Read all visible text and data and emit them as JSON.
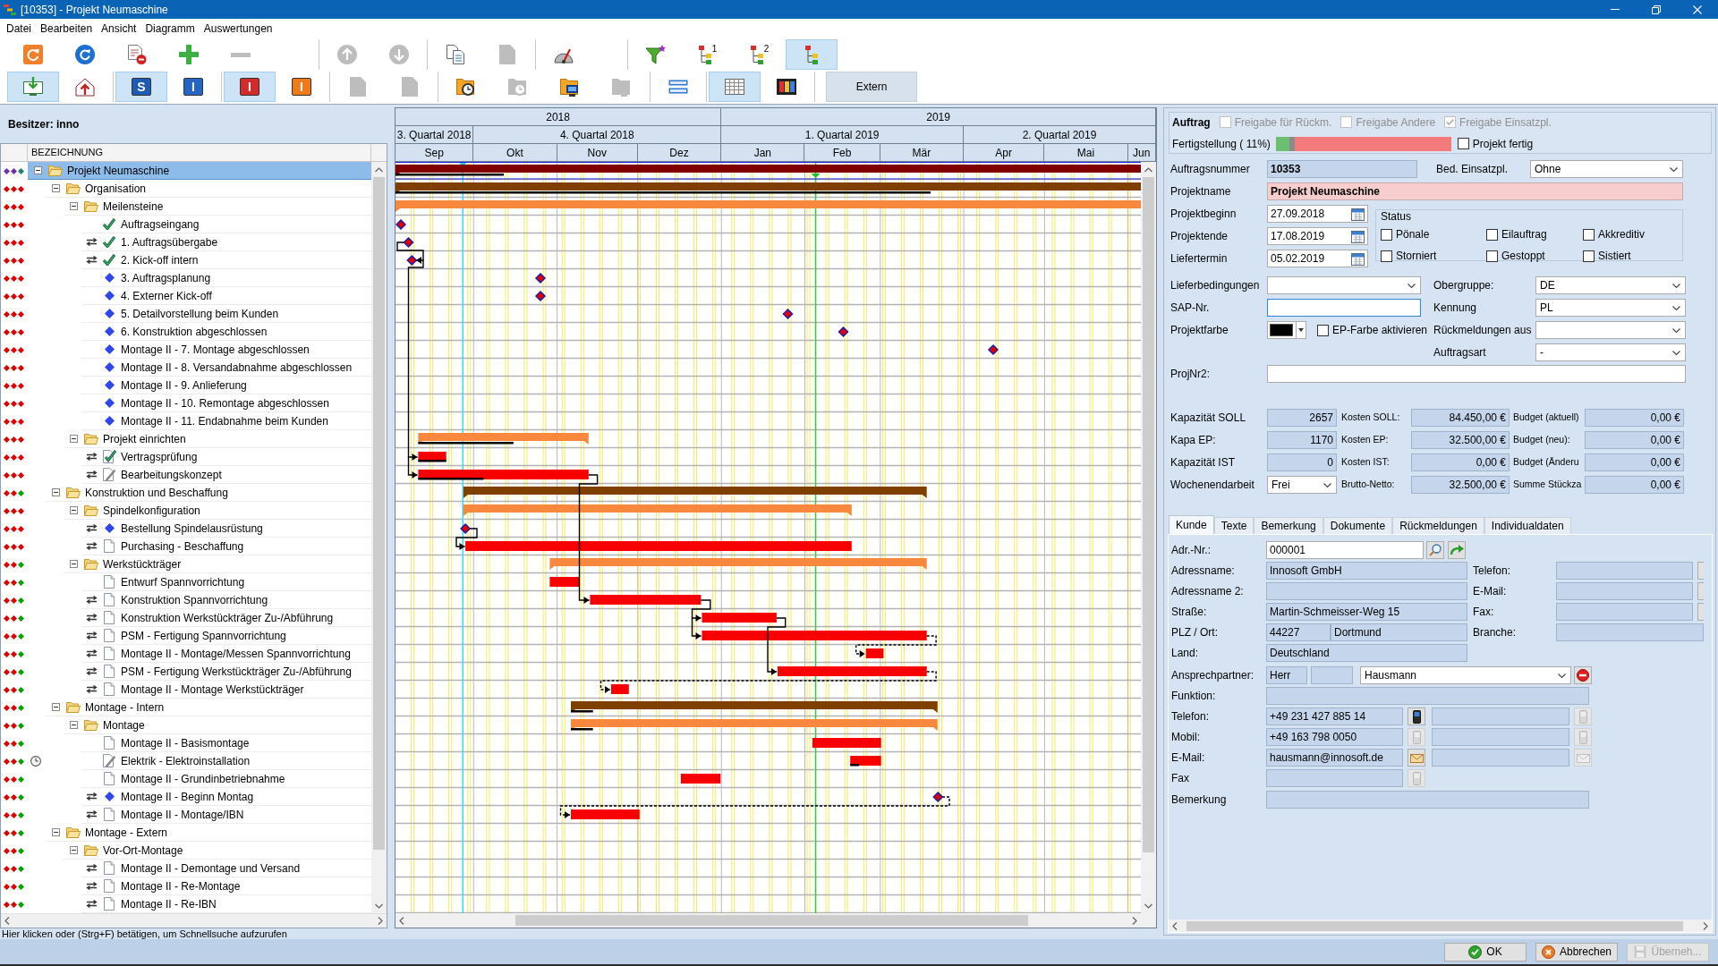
{
  "window": {
    "title": "[10353] - Projekt Neumaschine"
  },
  "menu": [
    "Datei",
    "Bearbeiten",
    "Ansicht",
    "Diagramm",
    "Auswertungen"
  ],
  "toolbar": {
    "rows": [
      [
        [
          {
            "kind": "reload",
            "disabled": false,
            "selected": false
          },
          {
            "kind": "refresh",
            "disabled": false,
            "selected": false
          },
          {
            "kind": "doc-remove",
            "disabled": false,
            "selected": false
          },
          {
            "kind": "add",
            "disabled": false,
            "selected": false
          },
          {
            "kind": "remove",
            "disabled": true,
            "selected": false
          }
        ],
        [
          {
            "kind": "up",
            "disabled": true,
            "selected": false
          },
          {
            "kind": "down",
            "disabled": true,
            "selected": false
          }
        ],
        [
          {
            "kind": "copy",
            "disabled": false,
            "selected": false
          },
          {
            "kind": "page",
            "disabled": true,
            "selected": false
          }
        ],
        [
          {
            "kind": "gauge",
            "disabled": false,
            "selected": false
          }
        ],
        [
          {
            "kind": "filter",
            "disabled": false,
            "selected": false
          },
          {
            "kind": "hierarchy",
            "glyph": "1",
            "disabled": false,
            "selected": false
          },
          {
            "kind": "hierarchy",
            "glyph": "2",
            "disabled": false,
            "selected": false
          },
          {
            "kind": "hierarchy",
            "disabled": false,
            "selected": true
          }
        ]
      ],
      [
        [
          {
            "kind": "import",
            "disabled": false,
            "selected": true
          },
          {
            "kind": "export",
            "disabled": false,
            "selected": false
          }
        ],
        [
          {
            "kind": "letter",
            "glyph": "S",
            "color": "#1f5bb5",
            "disabled": false,
            "selected": true
          },
          {
            "kind": "letter",
            "glyph": "I",
            "color": "#2563c4",
            "disabled": false,
            "selected": false
          }
        ],
        [
          {
            "kind": "letter",
            "glyph": "I",
            "color": "#d42a2a",
            "disabled": false,
            "selected": true
          },
          {
            "kind": "letter",
            "glyph": "I",
            "color": "#f07a1a",
            "disabled": false,
            "selected": false
          }
        ],
        [
          {
            "kind": "page",
            "disabled": true,
            "selected": false
          },
          {
            "kind": "page",
            "disabled": true,
            "selected": false
          }
        ],
        [
          {
            "kind": "folder-clock",
            "disabled": false,
            "selected": false
          },
          {
            "kind": "folder-clock",
            "disabled": true,
            "selected": false
          },
          {
            "kind": "folder-screen",
            "disabled": false,
            "selected": false
          },
          {
            "kind": "folder-screen",
            "disabled": true,
            "selected": false
          }
        ],
        [
          {
            "kind": "rows",
            "disabled": false,
            "selected": false
          }
        ],
        [
          {
            "kind": "grid",
            "disabled": false,
            "selected": true
          },
          {
            "kind": "film",
            "disabled": false,
            "selected": false
          }
        ],
        [
          {
            "kind": "text",
            "label": "Extern",
            "disabled": false,
            "selected": false
          }
        ]
      ]
    ]
  },
  "owner": "Besitzer: inno",
  "tree": {
    "column": "BEZEICHNUNG",
    "items": [
      {
        "label": "Projekt Neumaschine",
        "kind": "folder",
        "clock": false,
        "selected": true,
        "expanded": true,
        "dots": [
          {
            "color": "#7030a0"
          },
          {
            "color": "#7030a0"
          },
          {
            "color": "#208070"
          }
        ],
        "children": [
          {
            "label": "Organisation",
            "kind": "folder",
            "clock": false,
            "selected": false,
            "expanded": true,
            "dots": [
              {
                "color": "#e00000"
              },
              {
                "color": "#e00000"
              },
              {
                "color": "#e00000"
              }
            ],
            "children": [
              {
                "label": "Meilensteine",
                "kind": "folder",
                "clock": false,
                "selected": false,
                "expanded": true,
                "dots": [
                  {
                    "color": "#e00000"
                  },
                  {
                    "color": "#e00000"
                  },
                  {
                    "color": "#e00000"
                  }
                ],
                "children": [
                  {
                    "label": "Auftragseingang",
                    "kind": "check",
                    "linked": false,
                    "clock": false,
                    "selected": false,
                    "dots": [
                      {
                        "color": "#e00000"
                      },
                      {
                        "color": "#e00000"
                      },
                      {
                        "color": "#e00000"
                      }
                    ]
                  },
                  {
                    "label": "1. Auftragsübergabe",
                    "kind": "check",
                    "linked": true,
                    "clock": false,
                    "selected": false,
                    "dots": [
                      {
                        "color": "#e00000"
                      },
                      {
                        "color": "#e00000"
                      },
                      {
                        "color": "#e00000"
                      }
                    ]
                  },
                  {
                    "label": "2. Kick-off intern",
                    "kind": "check",
                    "linked": true,
                    "clock": false,
                    "selected": false,
                    "dots": [
                      {
                        "color": "#e00000"
                      },
                      {
                        "color": "#e00000"
                      },
                      {
                        "color": "#e00000"
                      }
                    ]
                  },
                  {
                    "label": "3. Auftragsplanung",
                    "kind": "diamond",
                    "linked": false,
                    "clock": false,
                    "selected": false,
                    "dots": [
                      {
                        "color": "#e00000"
                      },
                      {
                        "color": "#e00000"
                      },
                      {
                        "color": "#e00000"
                      }
                    ]
                  },
                  {
                    "label": "4. Externer Kick-off",
                    "kind": "diamond",
                    "linked": false,
                    "clock": false,
                    "selected": false,
                    "dots": [
                      {
                        "color": "#e00000"
                      },
                      {
                        "color": "#e00000"
                      },
                      {
                        "color": "#e00000"
                      }
                    ]
                  },
                  {
                    "label": "5. Detailvorstellung beim Kunden",
                    "kind": "diamond",
                    "linked": false,
                    "clock": false,
                    "selected": false,
                    "dots": [
                      {
                        "color": "#e00000"
                      },
                      {
                        "color": "#e00000"
                      },
                      {
                        "color": "#e00000"
                      }
                    ]
                  },
                  {
                    "label": "6. Konstruktion abgeschlossen",
                    "kind": "diamond",
                    "linked": false,
                    "clock": false,
                    "selected": false,
                    "dots": [
                      {
                        "color": "#e00000"
                      },
                      {
                        "color": "#e00000"
                      },
                      {
                        "color": "#e00000"
                      }
                    ]
                  },
                  {
                    "label": "Montage II - 7. Montage abgeschlossen",
                    "kind": "diamond",
                    "linked": false,
                    "clock": false,
                    "selected": false,
                    "dots": [
                      {
                        "color": "#e00000"
                      },
                      {
                        "color": "#e00000"
                      },
                      {
                        "color": "#e00000"
                      }
                    ]
                  },
                  {
                    "label": "Montage II - 8. Versandabnahme abgeschlossen",
                    "kind": "diamond",
                    "linked": false,
                    "clock": false,
                    "selected": false,
                    "dots": [
                      {
                        "color": "#e00000"
                      },
                      {
                        "color": "#e00000"
                      },
                      {
                        "color": "#e00000"
                      }
                    ]
                  },
                  {
                    "label": "Montage II - 9. Anlieferung",
                    "kind": "diamond",
                    "linked": false,
                    "clock": false,
                    "selected": false,
                    "dots": [
                      {
                        "color": "#e00000"
                      },
                      {
                        "color": "#e00000"
                      },
                      {
                        "color": "#e00000"
                      }
                    ]
                  },
                  {
                    "label": "Montage II - 10. Remontage abgeschlossen",
                    "kind": "diamond",
                    "linked": false,
                    "clock": false,
                    "selected": false,
                    "dots": [
                      {
                        "color": "#e00000"
                      },
                      {
                        "color": "#e00000"
                      },
                      {
                        "color": "#e00000"
                      }
                    ]
                  },
                  {
                    "label": "Montage II - 11. Endabnahme beim Kunden",
                    "kind": "diamond",
                    "linked": false,
                    "clock": false,
                    "selected": false,
                    "dots": [
                      {
                        "color": "#e00000"
                      },
                      {
                        "color": "#e00000"
                      },
                      {
                        "color": "#e00000"
                      }
                    ]
                  }
                ]
              },
              {
                "label": "Projekt einrichten",
                "kind": "folder",
                "clock": false,
                "selected": false,
                "expanded": true,
                "dots": [
                  {
                    "color": "#e00000"
                  },
                  {
                    "color": "#e00000"
                  },
                  {
                    "color": "#e00000"
                  }
                ],
                "children": [
                  {
                    "label": "Vertragsprüfung",
                    "kind": "check-doc",
                    "linked": true,
                    "clock": false,
                    "selected": false,
                    "dots": [
                      {
                        "color": "#e00000"
                      },
                      {
                        "color": "#e00000"
                      },
                      {
                        "color": "#e00000"
                      }
                    ]
                  },
                  {
                    "label": "Bearbeitungskonzept",
                    "kind": "pencil-doc",
                    "linked": true,
                    "clock": false,
                    "selected": false,
                    "dots": [
                      {
                        "color": "#e00000"
                      },
                      {
                        "color": "#e00000"
                      },
                      {
                        "color": "#e00000"
                      }
                    ]
                  }
                ]
              }
            ]
          },
          {
            "label": "Konstruktion und Beschaffung",
            "kind": "folder",
            "clock": false,
            "selected": false,
            "expanded": true,
            "dots": [
              {
                "color": "#e00000"
              },
              {
                "color": "#e00000"
              },
              {
                "color": "#00a000"
              }
            ],
            "children": [
              {
                "label": "Spindelkonfiguration",
                "kind": "folder",
                "clock": false,
                "selected": false,
                "expanded": true,
                "dots": [
                  {
                    "color": "#e00000"
                  },
                  {
                    "color": "#e00000"
                  },
                  {
                    "color": "#e00000"
                  }
                ],
                "children": [
                  {
                    "label": "Bestellung Spindelausrüstung",
                    "kind": "diamond",
                    "linked": true,
                    "clock": false,
                    "selected": false,
                    "dots": [
                      {
                        "color": "#e00000"
                      },
                      {
                        "color": "#e00000"
                      },
                      {
                        "color": "#e00000"
                      }
                    ]
                  },
                  {
                    "label": "Purchasing - Beschaffung",
                    "kind": "doc",
                    "linked": true,
                    "clock": false,
                    "selected": false,
                    "dots": [
                      {
                        "color": "#e00000"
                      },
                      {
                        "color": "#e00000"
                      },
                      {
                        "color": "#e00000"
                      }
                    ]
                  }
                ]
              },
              {
                "label": "Werkstückträger",
                "kind": "folder",
                "clock": false,
                "selected": false,
                "expanded": true,
                "dots": [
                  {
                    "color": "#e00000"
                  },
                  {
                    "color": "#e00000"
                  },
                  {
                    "color": "#00a000"
                  }
                ],
                "children": [
                  {
                    "label": "Entwurf Spannvorrichtung",
                    "kind": "doc",
                    "linked": false,
                    "clock": false,
                    "selected": false,
                    "dots": [
                      {
                        "color": "#e00000"
                      },
                      {
                        "color": "#e00000"
                      },
                      {
                        "color": "#00a000"
                      }
                    ]
                  },
                  {
                    "label": "Konstruktion Spannvorrichtung",
                    "kind": "doc",
                    "linked": true,
                    "clock": false,
                    "selected": false,
                    "dots": [
                      {
                        "color": "#e00000"
                      },
                      {
                        "color": "#e00000"
                      },
                      {
                        "color": "#00a000"
                      }
                    ]
                  },
                  {
                    "label": "Konstruktion Werkstückträger Zu-/Abführung",
                    "kind": "doc",
                    "linked": true,
                    "clock": false,
                    "selected": false,
                    "dots": [
                      {
                        "color": "#e00000"
                      },
                      {
                        "color": "#e00000"
                      },
                      {
                        "color": "#00a000"
                      }
                    ]
                  },
                  {
                    "label": "PSM - Fertigung Spannvorrichtung",
                    "kind": "doc",
                    "linked": true,
                    "clock": false,
                    "selected": false,
                    "dots": [
                      {
                        "color": "#e00000"
                      },
                      {
                        "color": "#e00000"
                      },
                      {
                        "color": "#00a000"
                      }
                    ]
                  },
                  {
                    "label": "Montage II - Montage/Messen Spannvorrichtung",
                    "kind": "doc",
                    "linked": true,
                    "clock": false,
                    "selected": false,
                    "dots": [
                      {
                        "color": "#e00000"
                      },
                      {
                        "color": "#e00000"
                      },
                      {
                        "color": "#00a000"
                      }
                    ]
                  },
                  {
                    "label": "PSM - Fertigung Werkstückträger Zu-/Abführung",
                    "kind": "doc",
                    "linked": true,
                    "clock": false,
                    "selected": false,
                    "dots": [
                      {
                        "color": "#e00000"
                      },
                      {
                        "color": "#e00000"
                      },
                      {
                        "color": "#00a000"
                      }
                    ]
                  },
                  {
                    "label": "Montage II - Montage Werkstückträger",
                    "kind": "doc",
                    "linked": true,
                    "clock": false,
                    "selected": false,
                    "dots": [
                      {
                        "color": "#e00000"
                      },
                      {
                        "color": "#e00000"
                      },
                      {
                        "color": "#00a000"
                      }
                    ]
                  }
                ]
              }
            ]
          },
          {
            "label": "Montage - Intern",
            "kind": "folder",
            "clock": false,
            "selected": false,
            "expanded": true,
            "dots": [
              {
                "color": "#e00000"
              },
              {
                "color": "#e00000"
              },
              {
                "color": "#00a000"
              }
            ],
            "children": [
              {
                "label": "Montage",
                "kind": "folder",
                "clock": false,
                "selected": false,
                "expanded": true,
                "dots": [
                  {
                    "color": "#e00000"
                  },
                  {
                    "color": "#e00000"
                  },
                  {
                    "color": "#00a000"
                  }
                ],
                "children": [
                  {
                    "label": "Montage II - Basismontage",
                    "kind": "doc",
                    "linked": false,
                    "clock": false,
                    "selected": false,
                    "dots": [
                      {
                        "color": "#e00000"
                      },
                      {
                        "color": "#e00000"
                      },
                      {
                        "color": "#00a000"
                      }
                    ]
                  },
                  {
                    "label": "Elektrik - Elektroinstallation",
                    "kind": "pencil-doc",
                    "linked": false,
                    "clock": true,
                    "selected": false,
                    "dots": [
                      {
                        "color": "#e00000"
                      },
                      {
                        "color": "#e00000"
                      },
                      {
                        "color": "#00a000"
                      }
                    ]
                  },
                  {
                    "label": "Montage II - Grundinbetriebnahme",
                    "kind": "doc",
                    "linked": false,
                    "clock": false,
                    "selected": false,
                    "dots": [
                      {
                        "color": "#e00000"
                      },
                      {
                        "color": "#e00000"
                      },
                      {
                        "color": "#00a000"
                      }
                    ]
                  },
                  {
                    "label": "Montage II - Beginn Montag",
                    "kind": "diamond",
                    "linked": true,
                    "clock": false,
                    "selected": false,
                    "dots": [
                      {
                        "color": "#e00000"
                      },
                      {
                        "color": "#e00000"
                      },
                      {
                        "color": "#00a000"
                      }
                    ]
                  },
                  {
                    "label": "Montage II - Montage/IBN",
                    "kind": "doc",
                    "linked": true,
                    "clock": false,
                    "selected": false,
                    "dots": [
                      {
                        "color": "#e00000"
                      },
                      {
                        "color": "#e00000"
                      },
                      {
                        "color": "#00a000"
                      }
                    ]
                  }
                ]
              }
            ]
          },
          {
            "label": "Montage - Extern",
            "kind": "folder",
            "clock": false,
            "selected": false,
            "expanded": true,
            "dots": [
              {
                "color": "#e00000"
              },
              {
                "color": "#e00000"
              },
              {
                "color": "#00a000"
              }
            ],
            "children": [
              {
                "label": "Vor-Ort-Montage",
                "kind": "folder",
                "clock": false,
                "selected": false,
                "expanded": true,
                "dots": [
                  {
                    "color": "#e00000"
                  },
                  {
                    "color": "#e00000"
                  },
                  {
                    "color": "#00a000"
                  }
                ],
                "children": [
                  {
                    "label": "Montage II - Demontage und Versand",
                    "kind": "doc",
                    "linked": true,
                    "clock": false,
                    "selected": false,
                    "dots": [
                      {
                        "color": "#e00000"
                      },
                      {
                        "color": "#e00000"
                      },
                      {
                        "color": "#00a000"
                      }
                    ]
                  },
                  {
                    "label": "Montage II - Re-Montage",
                    "kind": "doc",
                    "linked": true,
                    "clock": false,
                    "selected": false,
                    "dots": [
                      {
                        "color": "#e00000"
                      },
                      {
                        "color": "#e00000"
                      },
                      {
                        "color": "#00a000"
                      }
                    ]
                  },
                  {
                    "label": "Montage II - Re-IBN",
                    "kind": "doc",
                    "linked": true,
                    "clock": false,
                    "selected": false,
                    "dots": [
                      {
                        "color": "#e00000"
                      },
                      {
                        "color": "#e00000"
                      },
                      {
                        "color": "#00a000"
                      }
                    ]
                  }
                ]
              }
            ]
          }
        ]
      }
    ]
  },
  "gantt": {
    "years": [
      "2018",
      "2019"
    ],
    "quarters": [
      "3. Quartal 2018",
      "4. Quartal 2018",
      "1. Quartal 2019",
      "2. Quartal 2019"
    ],
    "months": [
      "Sep",
      "Okt",
      "Nov",
      "Dez",
      "Jan",
      "Feb",
      "Mär",
      "Apr",
      "Mai",
      "Jun"
    ]
  },
  "order": {
    "title": "Auftrag",
    "release_flags": [
      {
        "label": "Freigabe für Rückm.",
        "checked": false,
        "disabled": true
      },
      {
        "label": "Freigabe Andere",
        "checked": false,
        "disabled": true
      },
      {
        "label": "Freigabe Einsatzpl.",
        "checked": true,
        "disabled": true
      }
    ],
    "progress": {
      "label": "Fertigstellung ( 11%)",
      "level": 0.11
    },
    "finished": {
      "label": "Projekt fertig",
      "checked": false
    },
    "order_number": {
      "label": "Auftragsnummer",
      "value": "10353"
    },
    "deployment": {
      "label": "Bed. Einsatzpl.",
      "value": "Ohne"
    },
    "project_name": {
      "label": "Projektname",
      "value": "Projekt Neumaschine"
    },
    "dates": [
      {
        "label": "Projektbeginn",
        "value": "27.09.2018"
      },
      {
        "label": "Projektende",
        "value": "17.08.2019"
      },
      {
        "label": "Liefertermin",
        "value": "05.02.2019"
      }
    ],
    "status": {
      "title": "Status",
      "flags": [
        {
          "label": "Pönale",
          "checked": false
        },
        {
          "label": "Eilauftrag",
          "checked": false
        },
        {
          "label": "Akkreditiv",
          "checked": false
        },
        {
          "label": "Storniert",
          "checked": false
        },
        {
          "label": "Gestoppt",
          "checked": false
        },
        {
          "label": "Sistiert",
          "checked": false
        }
      ]
    },
    "delivery_terms": {
      "label": "Lieferbedingungen"
    },
    "sap_number": {
      "label": "SAP-Nr.",
      "focused": true
    },
    "project_color": {
      "label": "Projektfarbe",
      "color": "#000000"
    },
    "ep_color": {
      "label": "EP-Farbe aktivieren",
      "checked": false
    },
    "parent_group": {
      "label": "Obergruppe:",
      "value": "DE"
    },
    "identifier": {
      "label": "Kennung",
      "value": "PL"
    },
    "feedback_source": {
      "label": "Rückmeldungen aus"
    },
    "order_type": {
      "label": "Auftragsart",
      "value": "-"
    },
    "proj_nr2": {
      "label": "ProjNr2:"
    },
    "figures": [
      [
        {
          "kind": "readonly",
          "label": "Kapazität SOLL",
          "value": "2657"
        },
        {
          "kind": "readonly",
          "label": "Kosten SOLL:",
          "value": "84.450,00 €"
        },
        {
          "kind": "readonly",
          "label": "Budget (aktuell)",
          "value": "0,00 €"
        }
      ],
      [
        {
          "kind": "readonly",
          "label": "Kapa EP:",
          "value": "1170"
        },
        {
          "kind": "readonly",
          "label": "Kosten EP:",
          "value": "32.500,00 €"
        },
        {
          "kind": "readonly",
          "label": "Budget (neu):",
          "value": "0,00 €"
        }
      ],
      [
        {
          "kind": "readonly",
          "label": "Kapazität IST",
          "value": "0"
        },
        {
          "kind": "readonly",
          "label": "Kosten IST:",
          "value": "0,00 €"
        },
        {
          "kind": "readonly",
          "label": "Budget (Änderu",
          "value": "0,00 €"
        }
      ],
      [
        {
          "kind": "select",
          "label": "Wochenendarbeit",
          "value": "Frei"
        },
        {
          "kind": "readonly",
          "label": "Brutto-Netto:",
          "value": "32.500,00 €"
        },
        {
          "kind": "readonly",
          "label": "Summe Stückza",
          "value": "0,00 €"
        }
      ]
    ]
  },
  "tabs": [
    {
      "label": "Kunde",
      "selected": true
    },
    {
      "label": "Texte",
      "selected": false
    },
    {
      "label": "Bemerkung",
      "selected": false
    },
    {
      "label": "Dokumente",
      "selected": false
    },
    {
      "label": "Rückmeldungen",
      "selected": false
    },
    {
      "label": "Individualdaten",
      "selected": false
    }
  ],
  "customer": {
    "address_no": {
      "label": "Adr.-Nr.:",
      "value": "000001"
    },
    "address": [
      {
        "label": "Adressname:",
        "value": "Innosoft GmbH"
      },
      {
        "label": "Adressname 2:"
      },
      {
        "label": "Straße:",
        "value": "Martin-Schmeisser-Weg 15"
      },
      {
        "label": "PLZ / Ort:",
        "value": "44227",
        "city": "Dortmund"
      },
      {
        "label": "Land:",
        "value": "Deutschland"
      }
    ],
    "contact_fields": [
      {
        "label": "Telefon:",
        "button": true
      },
      {
        "label": "E-Mail:",
        "button": true
      },
      {
        "label": "Fax:",
        "button": true
      },
      {
        "label": "Branche:",
        "button": false
      }
    ],
    "contact_person": {
      "label": "Ansprechpartner:",
      "salutation": "Herr",
      "name": "Hausmann"
    },
    "function": {
      "label": "Funktion:"
    },
    "channels": [
      {
        "kind": "phone",
        "label": "Telefon:",
        "value": "+49 231 427 885 14",
        "enabled": true,
        "second": true
      },
      {
        "kind": "phone",
        "label": "Mobil:",
        "value": "+49 163 798 0050",
        "enabled": false,
        "second": true
      },
      {
        "kind": "mail",
        "label": "E-Mail:",
        "value": "hausmann@innosoft.de",
        "enabled": true,
        "second": true
      },
      {
        "kind": "phone",
        "label": "Fax",
        "enabled": false,
        "second": false
      }
    ],
    "remark": {
      "label": "Bemerkung"
    }
  },
  "status_bar": "Hier klicken oder (Strg+F) betätigen, um Schnellsuche aufzurufen",
  "buttons": [
    {
      "kind": "ok",
      "label": "OK",
      "disabled": false
    },
    {
      "kind": "cancel",
      "label": "Abbrechen",
      "disabled": false
    },
    {
      "kind": "apply",
      "label": "Überneh...",
      "disabled": true
    }
  ]
}
